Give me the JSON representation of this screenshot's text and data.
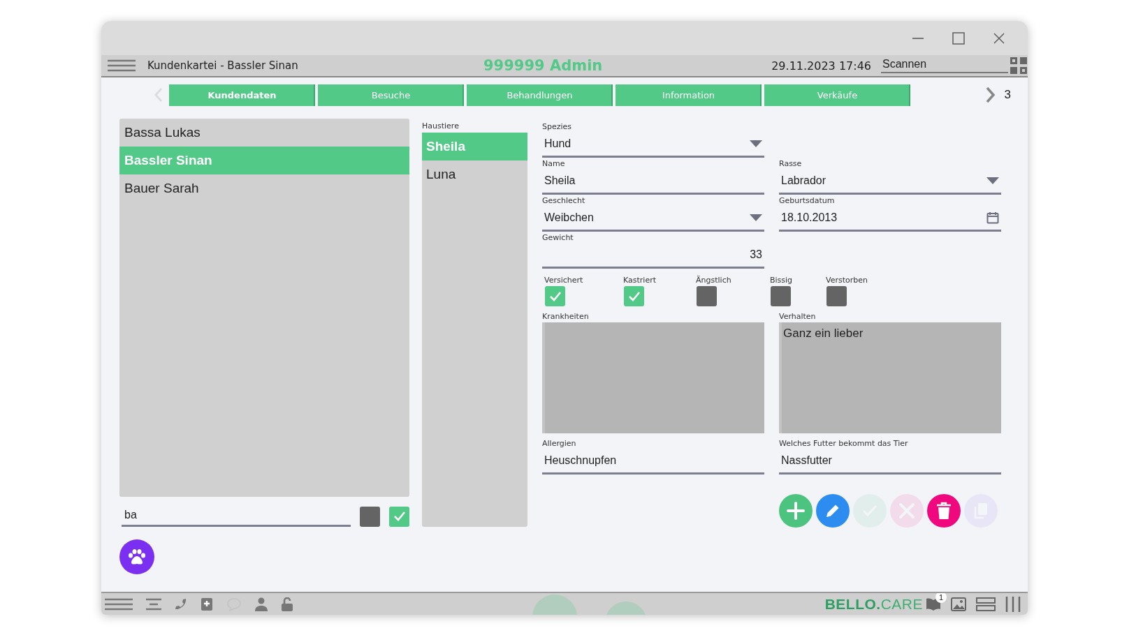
{
  "header": {
    "title": "Kundenkartei - Bassler Sinan",
    "user": "999999 Admin",
    "datetime": "29.11.2023 17:46",
    "scan_field": {
      "value": "Scannen"
    }
  },
  "tabs": [
    {
      "label": "Kundendaten",
      "selected": true
    },
    {
      "label": "Besuche",
      "selected": false
    },
    {
      "label": "Behandlungen",
      "selected": false
    },
    {
      "label": "Information",
      "selected": false
    },
    {
      "label": "Verkäufe",
      "selected": false
    }
  ],
  "pager": {
    "prev_disabled": true,
    "page": "3"
  },
  "customers": {
    "items": [
      {
        "name": "Bassa Lukas",
        "selected": false
      },
      {
        "name": "Bassler Sinan",
        "selected": true
      },
      {
        "name": "Bauer Sarah",
        "selected": false
      }
    ],
    "search": {
      "value": "ba"
    },
    "filters": [
      {
        "checked": false
      },
      {
        "checked": true
      }
    ]
  },
  "pets": {
    "label": "Haustiere",
    "items": [
      {
        "name": "Sheila",
        "selected": true
      },
      {
        "name": "Luna",
        "selected": false
      }
    ]
  },
  "form": {
    "rows": [
      {
        "fields": [
          {
            "label": "Spezies",
            "value": "Hund",
            "kind": "select"
          }
        ]
      },
      {
        "fields": [
          {
            "label": "Name",
            "value": "Sheila",
            "kind": "text"
          },
          {
            "label": "Rasse",
            "value": "Labrador",
            "kind": "select"
          }
        ]
      },
      {
        "fields": [
          {
            "label": "Geschlecht",
            "value": "Weibchen",
            "kind": "select"
          },
          {
            "label": "Geburtsdatum",
            "value": "18.10.2013",
            "kind": "date"
          }
        ]
      },
      {
        "fields": [
          {
            "label": "Gewicht",
            "value": "33",
            "kind": "number"
          }
        ]
      }
    ],
    "flags": [
      {
        "label": "Versichert",
        "checked": true
      },
      {
        "label": "Kastriert",
        "checked": true
      },
      {
        "label": "Ängstlich",
        "checked": false
      },
      {
        "label": "Bissig",
        "checked": false
      },
      {
        "label": "Verstorben",
        "checked": false
      }
    ],
    "notes": [
      {
        "label": "Krankheiten"
      },
      {
        "label": "Verhalten",
        "value": "Ganz ein lieber"
      }
    ],
    "extra": [
      {
        "label": "Allergien",
        "value": "Heuschnupfen"
      },
      {
        "label": "Welches Futter bekommt das Tier",
        "value": "Nassfutter"
      }
    ]
  },
  "actions": [
    {
      "kind": "add",
      "disabled": false
    },
    {
      "kind": "edit",
      "disabled": false
    },
    {
      "kind": "confirm",
      "disabled": true
    },
    {
      "kind": "cancel",
      "disabled": true
    },
    {
      "kind": "delete",
      "disabled": false
    },
    {
      "kind": "copy",
      "disabled": true
    }
  ],
  "bottom_bar": {
    "logo_bold": "BELLO.",
    "logo_light": "CARE",
    "badge": "1"
  }
}
